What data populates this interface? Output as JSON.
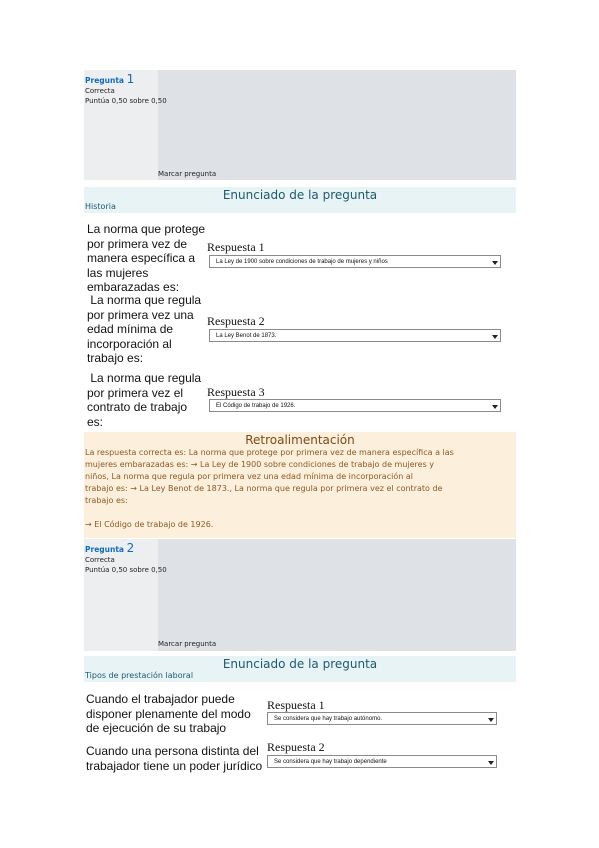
{
  "question1": {
    "label": "Pregunta",
    "number": "1",
    "state": "Correcta",
    "grade": "Puntúa 0,50 sobre 0,50",
    "flag": "Marcar pregunta",
    "statement_header": "Enunciado de la pregunta",
    "topic": "Historia",
    "items": [
      {
        "text_lines": [
          "La norma que protege",
          "por primera vez de",
          "manera específica a",
          "las mujeres",
          "embarazadas es:"
        ],
        "response_label": "Respuesta 1",
        "selected": "La Ley de 1900 sobre condiciones de trabajo de mujeres y niños"
      },
      {
        "text_lines": [
          " La norma que regula",
          "por primera vez una",
          "edad mínima de",
          "incorporación al",
          "trabajo es:"
        ],
        "response_label": "Respuesta 2",
        "selected": "La Ley Benot de 1873."
      },
      {
        "text_lines": [
          " La norma que regula",
          "por primera vez el",
          "contrato de trabajo",
          "es:"
        ],
        "response_label": "Respuesta 3",
        "selected": "El Código de trabajo de 1926."
      }
    ],
    "feedback": {
      "header": "Retroalimentación",
      "lines": [
        "La respuesta correcta es: La norma que protege por primera vez de manera específica a las",
        "mujeres embarazadas es:  → La Ley de 1900 sobre condiciones de trabajo de mujeres y",
        "niños,  La norma que regula por primera vez una edad mínima de incorporación al",
        "trabajo es:  → La Ley Benot de 1873.,  La norma que regula por primera vez el contrato de",
        "trabajo es:",
        "",
        "→ El Código de trabajo de 1926."
      ]
    }
  },
  "question2": {
    "label": "Pregunta",
    "number": "2",
    "state": "Correcta",
    "grade": "Puntúa 0,50 sobre 0,50",
    "flag": "Marcar pregunta",
    "statement_header": "Enunciado de la pregunta",
    "topic": "Tipos de prestación laboral",
    "items": [
      {
        "text_lines": [
          "Cuando el trabajador puede",
          "disponer plenamente del modo",
          "de ejecución de su trabajo"
        ],
        "response_label": "Respuesta 1",
        "selected": "Se considera que hay trabajo autónomo."
      },
      {
        "text_lines": [
          "Cuando una persona distinta del",
          "trabajador tiene un poder jurídico"
        ],
        "response_label": "Respuesta 2",
        "selected": "Se considera que hay trabajo dependiente"
      }
    ]
  }
}
